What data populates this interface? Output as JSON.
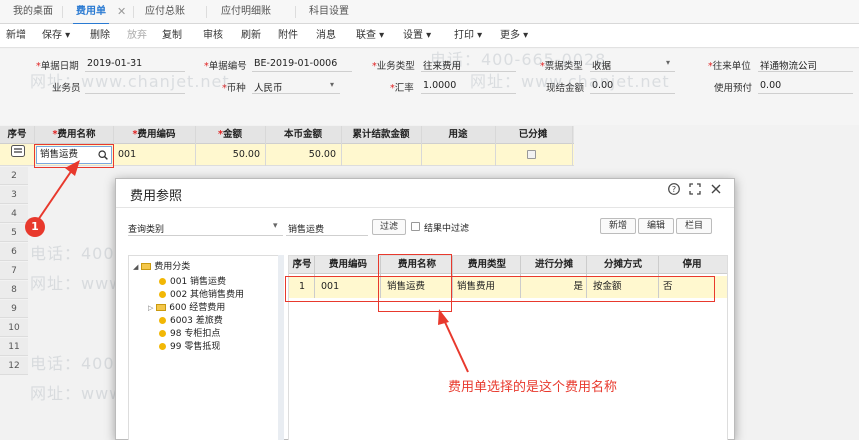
{
  "tabs": [
    {
      "label": "我的桌面",
      "active": false
    },
    {
      "label": "费用单",
      "active": true
    },
    {
      "label": "应付总账",
      "active": false
    },
    {
      "label": "应付明细账",
      "active": false
    },
    {
      "label": "科目设置",
      "active": false
    }
  ],
  "toolbar": {
    "new": "新增",
    "save": "保存",
    "delete": "删除",
    "discard": "放弃",
    "copy": "复制",
    "audit": "审核",
    "refresh": "刷新",
    "attach": "附件",
    "message": "消息",
    "link": "联查",
    "settings": "设置",
    "print": "打印",
    "more": "更多"
  },
  "form": {
    "doc_date_label": "单据日期",
    "doc_date": "2019-01-31",
    "doc_no_label": "单据编号",
    "doc_no": "BE-2019-01-0006",
    "biz_type_label": "业务类型",
    "biz_type": "往来费用",
    "bill_type_label": "票据类型",
    "bill_type": "收据",
    "partner_label": "往来单位",
    "partner": "祥通物流公司",
    "salesman_label": "业务员",
    "currency_label": "币种",
    "currency": "人民币",
    "rate_label": "汇率",
    "rate": "1.0000",
    "cash_label": "现结金额",
    "cash": "0.00",
    "prepay_label": "使用预付",
    "prepay": "0.00"
  },
  "grid": {
    "headers": [
      "序号",
      "费用名称",
      "费用编码",
      "金额",
      "本币金额",
      "累计结款金额",
      "用途",
      "已分摊"
    ],
    "row": {
      "name": "销售运费",
      "code": "001",
      "amount": "50.00",
      "local_amount": "50.00"
    },
    "row_numbers": [
      "2",
      "3",
      "4",
      "5",
      "6",
      "7",
      "8",
      "9",
      "10",
      "11",
      "12"
    ]
  },
  "dialog": {
    "title": "费用参照",
    "query_label": "查询类别",
    "search_value": "销售运费",
    "filter_btn": "过滤",
    "result_filter_label": "结果中过滤",
    "new_btn": "新增",
    "edit_btn": "编辑",
    "column_btn": "栏目",
    "tree": {
      "root": "费用分类",
      "items": [
        "001 销售运费",
        "002 其他销售费用",
        "600 经营费用",
        "6003 差旅费",
        "98 专柜扣点",
        "99 零售抵现"
      ]
    },
    "table": {
      "headers": [
        "序号",
        "费用编码",
        "费用名称",
        "费用类型",
        "进行分摊",
        "分摊方式",
        "停用"
      ],
      "row": {
        "no": "1",
        "code": "001",
        "name": "销售运费",
        "type": "销售费用",
        "allocate": "是",
        "method": "按金额",
        "disabled": "否"
      }
    }
  },
  "annotation": {
    "badge": "1",
    "text": "费用单选择的是这个费用名称"
  },
  "watermark": {
    "phone": "电话：400-665-0028",
    "site": "网址：www.chanjet.net"
  },
  "colors": {
    "accent": "#2a7ad2",
    "annotation": "#e8392d",
    "highlight_row": "#fff8cf"
  }
}
